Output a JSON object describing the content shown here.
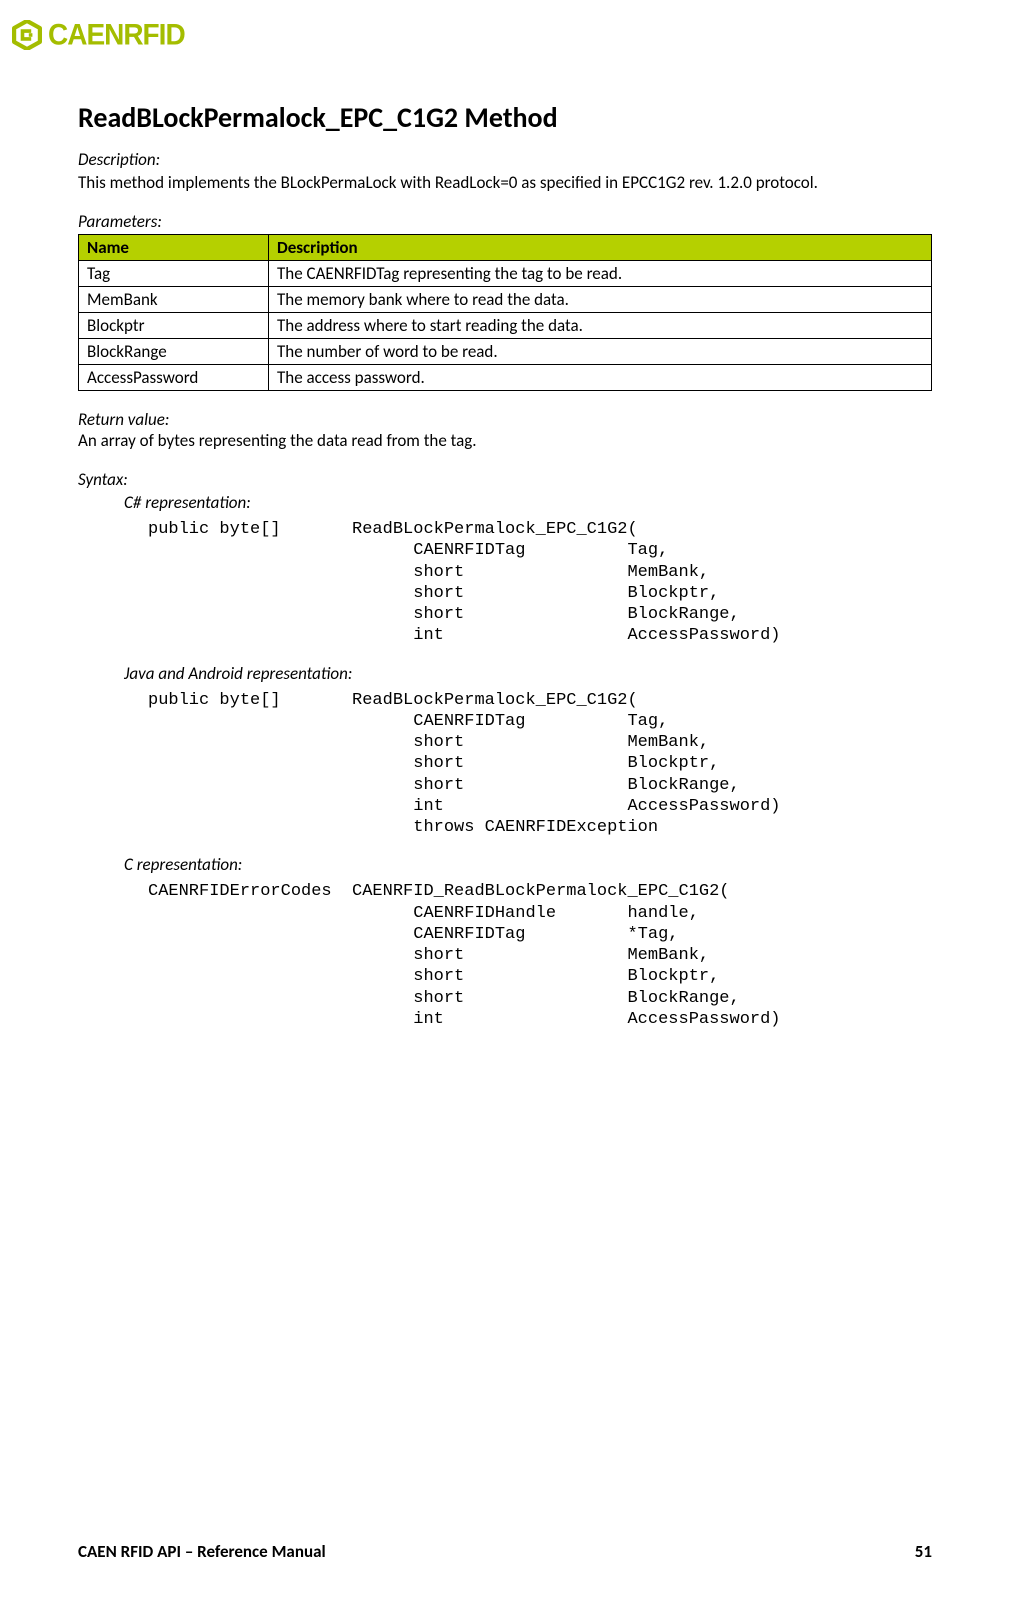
{
  "logo_text": "CAENRFID",
  "title": "ReadBLockPermalock_EPC_C1G2 Method",
  "description_label": "Description:",
  "description_text": "This method implements the BLockPermaLock with ReadLock=0 as specified in EPCC1G2 rev. 1.2.0 protocol.",
  "parameters_label": "Parameters:",
  "table_headers": {
    "name": "Name",
    "desc": "Description"
  },
  "params": [
    {
      "name": "Tag",
      "desc": "The CAENRFIDTag representing the tag to be read."
    },
    {
      "name": "MemBank",
      "desc": "The memory bank where to read the data."
    },
    {
      "name": "Blockptr",
      "desc": "The address where to start reading the data."
    },
    {
      "name": "BlockRange",
      "desc": "The number of word to be read."
    },
    {
      "name": "AccessPassword",
      "desc": "The access password."
    }
  ],
  "return_label": "Return value:",
  "return_text": "An array of bytes representing the data read from the tag.",
  "syntax_label": "Syntax:",
  "csharp_label": "C# representation:",
  "csharp_code": "public byte[]       ReadBLockPermalock_EPC_C1G2(\n                          CAENRFIDTag          Tag,\n                          short                MemBank,\n                          short                Blockptr,\n                          short                BlockRange,\n                          int                  AccessPassword)",
  "java_label": "Java and Android representation:",
  "java_code": "public byte[]       ReadBLockPermalock_EPC_C1G2(\n                          CAENRFIDTag          Tag,\n                          short                MemBank,\n                          short                Blockptr,\n                          short                BlockRange,\n                          int                  AccessPassword)\n                          throws CAENRFIDException",
  "c_label": "C representation:",
  "c_code": "CAENRFIDErrorCodes  CAENRFID_ReadBLockPermalock_EPC_C1G2(\n                          CAENRFIDHandle       handle,\n                          CAENRFIDTag          *Tag,\n                          short                MemBank,\n                          short                Blockptr,\n                          short                BlockRange,\n                          int                  AccessPassword)",
  "footer_left": "CAEN RFID API – Reference Manual",
  "footer_right": "51"
}
